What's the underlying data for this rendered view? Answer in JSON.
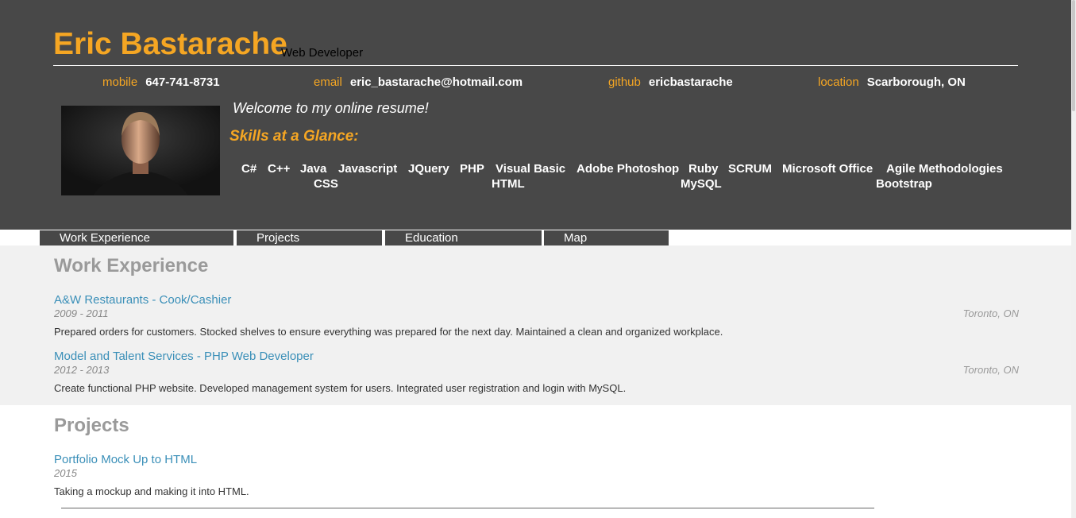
{
  "header": {
    "name": "Eric Bastarache",
    "role": "Web Developer",
    "contacts": [
      {
        "label": "mobile",
        "value": "647-741-8731"
      },
      {
        "label": "email",
        "value": "eric_bastarache@hotmail.com"
      },
      {
        "label": "github",
        "value": "ericbastarache"
      },
      {
        "label": "location",
        "value": "Scarborough, ON"
      }
    ],
    "welcome": "Welcome to my online resume!",
    "skills_heading": "Skills at a Glance:",
    "skills": [
      "C#",
      "C++",
      "Java",
      "Javascript",
      "JQuery",
      "PHP",
      "Visual Basic",
      "Adobe Photoshop",
      "Ruby",
      "SCRUM",
      "Microsoft Office",
      "Agile Methodologies",
      "CSS",
      "HTML",
      "MySQL",
      "Bootstrap"
    ]
  },
  "tabs": [
    "Work Experience",
    "Projects",
    "Education",
    "Map"
  ],
  "work": {
    "heading": "Work Experience",
    "jobs": [
      {
        "title": "A&W Restaurants - Cook/Cashier",
        "dates": "2009 - 2011",
        "location": "Toronto, ON",
        "description": "Prepared orders for customers. Stocked shelves to ensure everything was prepared for the next day. Maintained a clean and organized workplace."
      },
      {
        "title": "Model and Talent Services - PHP Web Developer",
        "dates": "2012 - 2013",
        "location": "Toronto, ON",
        "description": "Create functional PHP website. Developed management system for users. Integrated user registration and login with MySQL."
      }
    ]
  },
  "projects": {
    "heading": "Projects",
    "items": [
      {
        "title": "Portfolio Mock Up to HTML",
        "dates": "2015",
        "description": "Taking a mockup and making it into HTML."
      }
    ]
  },
  "colors": {
    "header_bg": "#484848",
    "accent": "#f5a623",
    "link": "#3a8fb8",
    "section_bg": "#f1f1f1"
  }
}
